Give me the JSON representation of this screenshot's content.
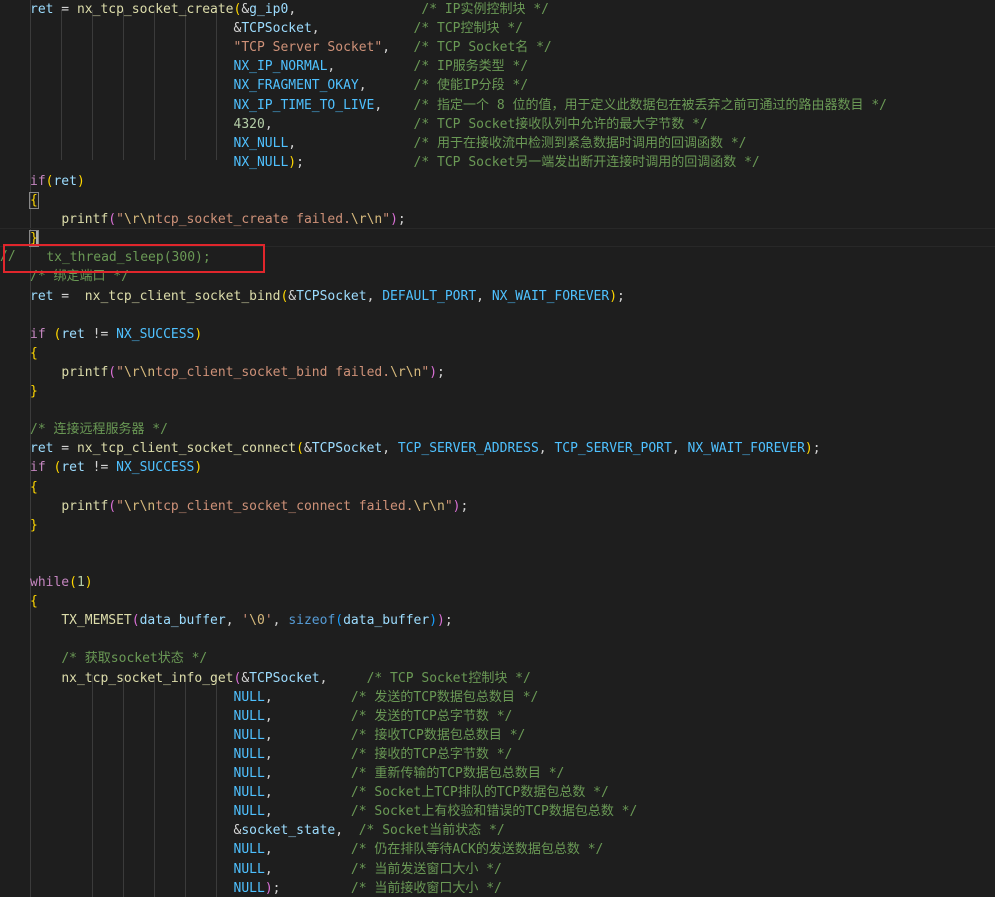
{
  "editor": {
    "colors": {
      "background": "#1e1e1e",
      "keyword": "#c586c0",
      "type": "#569cd6",
      "function": "#dcdcaa",
      "variable": "#9cdcfe",
      "macro": "#4fc1ff",
      "number": "#b5cea8",
      "string": "#ce9178",
      "comment": "#6a9955",
      "highlight_box": "#e0262c"
    },
    "lines": [
      [
        [
          "var",
          "ret"
        ],
        [
          "txt",
          " = "
        ],
        [
          "fn",
          "nx_tcp_socket_create"
        ],
        [
          "br1",
          "("
        ],
        [
          "txt",
          "&"
        ],
        [
          "var",
          "g_ip0"
        ],
        [
          "txt",
          ","
        ],
        [
          "txt",
          "                "
        ],
        [
          "cmt",
          "/* IP实例控制块 */"
        ]
      ],
      [
        [
          "txt",
          "                          &"
        ],
        [
          "var",
          "TCPSocket"
        ],
        [
          "txt",
          ","
        ],
        [
          "txt",
          "            "
        ],
        [
          "cmt",
          "/* TCP控制块 */"
        ]
      ],
      [
        [
          "txt",
          "                          "
        ],
        [
          "str",
          "\"TCP Server Socket\""
        ],
        [
          "txt",
          ",   "
        ],
        [
          "cmt",
          "/* TCP Socket名 */"
        ]
      ],
      [
        [
          "txt",
          "                          "
        ],
        [
          "mac",
          "NX_IP_NORMAL"
        ],
        [
          "txt",
          ","
        ],
        [
          "txt",
          "          "
        ],
        [
          "cmt",
          "/* IP服务类型 */"
        ]
      ],
      [
        [
          "txt",
          "                          "
        ],
        [
          "mac",
          "NX_FRAGMENT_OKAY"
        ],
        [
          "txt",
          ","
        ],
        [
          "txt",
          "      "
        ],
        [
          "cmt",
          "/* 使能IP分段 */"
        ]
      ],
      [
        [
          "txt",
          "                          "
        ],
        [
          "mac",
          "NX_IP_TIME_TO_LIVE"
        ],
        [
          "txt",
          ","
        ],
        [
          "txt",
          "    "
        ],
        [
          "cmt",
          "/* 指定一个 8 位的值，用于定义此数据包在被丢弃之前可通过的路由器数目 */"
        ]
      ],
      [
        [
          "txt",
          "                          "
        ],
        [
          "num",
          "4320"
        ],
        [
          "txt",
          ","
        ],
        [
          "txt",
          "                  "
        ],
        [
          "cmt",
          "/* TCP Socket接收队列中允许的最大字节数 */"
        ]
      ],
      [
        [
          "txt",
          "                          "
        ],
        [
          "mac",
          "NX_NULL"
        ],
        [
          "txt",
          ","
        ],
        [
          "txt",
          "               "
        ],
        [
          "cmt",
          "/* 用于在接收流中检测到紧急数据时调用的回调函数 */"
        ]
      ],
      [
        [
          "txt",
          "                          "
        ],
        [
          "mac",
          "NX_NULL"
        ],
        [
          "br1",
          ")"
        ],
        [
          "txt",
          ";"
        ],
        [
          "txt",
          "              "
        ],
        [
          "cmt",
          "/* TCP Socket另一端发出断开连接时调用的回调函数 */"
        ]
      ],
      [
        [
          "kw",
          "if"
        ],
        [
          "br1",
          "("
        ],
        [
          "var",
          "ret"
        ],
        [
          "br1",
          ")"
        ]
      ],
      [
        [
          "br1bm",
          "{"
        ]
      ],
      [
        [
          "txt",
          "    "
        ],
        [
          "fn",
          "printf"
        ],
        [
          "br2",
          "("
        ],
        [
          "str",
          "\""
        ],
        [
          "esc",
          "\\r\\n"
        ],
        [
          "str",
          "tcp_socket_create failed."
        ],
        [
          "esc",
          "\\r\\n"
        ],
        [
          "str",
          "\""
        ],
        [
          "br2",
          ")"
        ],
        [
          "txt",
          ";"
        ]
      ],
      [
        [
          "br1bm",
          "}"
        ]
      ],
      [
        [
          "txt",
          "    "
        ],
        [
          "cmt",
          "tx_thread_sleep(300);"
        ]
      ],
      [
        [
          "cmt",
          "/* 绑定端口 */"
        ]
      ],
      [
        [
          "var",
          "ret"
        ],
        [
          "txt",
          " =  "
        ],
        [
          "fn",
          "nx_tcp_client_socket_bind"
        ],
        [
          "br1",
          "("
        ],
        [
          "txt",
          "&"
        ],
        [
          "var",
          "TCPSocket"
        ],
        [
          "txt",
          ", "
        ],
        [
          "mac",
          "DEFAULT_PORT"
        ],
        [
          "txt",
          ", "
        ],
        [
          "mac",
          "NX_WAIT_FOREVER"
        ],
        [
          "br1",
          ")"
        ],
        [
          "txt",
          ";"
        ]
      ],
      [],
      [
        [
          "kw",
          "if"
        ],
        [
          "txt",
          " "
        ],
        [
          "br1",
          "("
        ],
        [
          "var",
          "ret"
        ],
        [
          "txt",
          " != "
        ],
        [
          "mac",
          "NX_SUCCESS"
        ],
        [
          "br1",
          ")"
        ]
      ],
      [
        [
          "br1",
          "{"
        ]
      ],
      [
        [
          "txt",
          "    "
        ],
        [
          "fn",
          "printf"
        ],
        [
          "br2",
          "("
        ],
        [
          "str",
          "\""
        ],
        [
          "esc",
          "\\r\\n"
        ],
        [
          "str",
          "tcp_client_socket_bind failed."
        ],
        [
          "esc",
          "\\r\\n"
        ],
        [
          "str",
          "\""
        ],
        [
          "br2",
          ")"
        ],
        [
          "txt",
          ";"
        ]
      ],
      [
        [
          "br1",
          "}"
        ]
      ],
      [],
      [
        [
          "cmt",
          "/* 连接远程服务器 */"
        ]
      ],
      [
        [
          "var",
          "ret"
        ],
        [
          "txt",
          " = "
        ],
        [
          "fn",
          "nx_tcp_client_socket_connect"
        ],
        [
          "br1",
          "("
        ],
        [
          "txt",
          "&"
        ],
        [
          "var",
          "TCPSocket"
        ],
        [
          "txt",
          ", "
        ],
        [
          "mac",
          "TCP_SERVER_ADDRESS"
        ],
        [
          "txt",
          ", "
        ],
        [
          "mac",
          "TCP_SERVER_PORT"
        ],
        [
          "txt",
          ", "
        ],
        [
          "mac",
          "NX_WAIT_FOREVER"
        ],
        [
          "br1",
          ")"
        ],
        [
          "txt",
          ";"
        ]
      ],
      [
        [
          "kw",
          "if"
        ],
        [
          "txt",
          " "
        ],
        [
          "br1",
          "("
        ],
        [
          "var",
          "ret"
        ],
        [
          "txt",
          " != "
        ],
        [
          "mac",
          "NX_SUCCESS"
        ],
        [
          "br1",
          ")"
        ]
      ],
      [
        [
          "br1",
          "{"
        ]
      ],
      [
        [
          "txt",
          "    "
        ],
        [
          "fn",
          "printf"
        ],
        [
          "br2",
          "("
        ],
        [
          "str",
          "\""
        ],
        [
          "esc",
          "\\r\\n"
        ],
        [
          "str",
          "tcp_client_socket_connect failed."
        ],
        [
          "esc",
          "\\r\\n"
        ],
        [
          "str",
          "\""
        ],
        [
          "br2",
          ")"
        ],
        [
          "txt",
          ";"
        ]
      ],
      [
        [
          "br1",
          "}"
        ]
      ],
      [],
      [],
      [
        [
          "kw",
          "while"
        ],
        [
          "br1",
          "("
        ],
        [
          "num",
          "1"
        ],
        [
          "br1",
          ")"
        ]
      ],
      [
        [
          "br1",
          "{"
        ]
      ],
      [
        [
          "txt",
          "    "
        ],
        [
          "fn",
          "TX_MEMSET"
        ],
        [
          "br2",
          "("
        ],
        [
          "var",
          "data_buffer"
        ],
        [
          "txt",
          ", "
        ],
        [
          "str",
          "'"
        ],
        [
          "esc",
          "\\0"
        ],
        [
          "str",
          "'"
        ],
        [
          "txt",
          ", "
        ],
        [
          "ty",
          "sizeof"
        ],
        [
          "br3",
          "("
        ],
        [
          "var",
          "data_buffer"
        ],
        [
          "br3",
          ")"
        ],
        [
          "br2",
          ")"
        ],
        [
          "txt",
          ";"
        ]
      ],
      [],
      [
        [
          "txt",
          "    "
        ],
        [
          "cmt",
          "/* 获取socket状态 */"
        ]
      ],
      [
        [
          "txt",
          "    "
        ],
        [
          "fn",
          "nx_tcp_socket_info_get"
        ],
        [
          "br2",
          "("
        ],
        [
          "txt",
          "&"
        ],
        [
          "var",
          "TCPSocket"
        ],
        [
          "txt",
          ","
        ],
        [
          "txt",
          "     "
        ],
        [
          "cmt",
          "/* TCP Socket控制块 */"
        ]
      ],
      [
        [
          "txt",
          "                          "
        ],
        [
          "mac",
          "NULL"
        ],
        [
          "txt",
          ","
        ],
        [
          "txt",
          "          "
        ],
        [
          "cmt",
          "/* 发送的TCP数据包总数目 */"
        ]
      ],
      [
        [
          "txt",
          "                          "
        ],
        [
          "mac",
          "NULL"
        ],
        [
          "txt",
          ","
        ],
        [
          "txt",
          "          "
        ],
        [
          "cmt",
          "/* 发送的TCP总字节数 */"
        ]
      ],
      [
        [
          "txt",
          "                          "
        ],
        [
          "mac",
          "NULL"
        ],
        [
          "txt",
          ","
        ],
        [
          "txt",
          "          "
        ],
        [
          "cmt",
          "/* 接收TCP数据包总数目 */"
        ]
      ],
      [
        [
          "txt",
          "                          "
        ],
        [
          "mac",
          "NULL"
        ],
        [
          "txt",
          ","
        ],
        [
          "txt",
          "          "
        ],
        [
          "cmt",
          "/* 接收的TCP总字节数 */"
        ]
      ],
      [
        [
          "txt",
          "                          "
        ],
        [
          "mac",
          "NULL"
        ],
        [
          "txt",
          ","
        ],
        [
          "txt",
          "          "
        ],
        [
          "cmt",
          "/* 重新传输的TCP数据包总数目 */"
        ]
      ],
      [
        [
          "txt",
          "                          "
        ],
        [
          "mac",
          "NULL"
        ],
        [
          "txt",
          ","
        ],
        [
          "txt",
          "          "
        ],
        [
          "cmt",
          "/* Socket上TCP排队的TCP数据包总数 */"
        ]
      ],
      [
        [
          "txt",
          "                          "
        ],
        [
          "mac",
          "NULL"
        ],
        [
          "txt",
          ","
        ],
        [
          "txt",
          "          "
        ],
        [
          "cmt",
          "/* Socket上有校验和错误的TCP数据包总数 */"
        ]
      ],
      [
        [
          "txt",
          "                          &"
        ],
        [
          "var",
          "socket_state"
        ],
        [
          "txt",
          ","
        ],
        [
          "txt",
          "  "
        ],
        [
          "cmt",
          "/* Socket当前状态 */"
        ]
      ],
      [
        [
          "txt",
          "                          "
        ],
        [
          "mac",
          "NULL"
        ],
        [
          "txt",
          ","
        ],
        [
          "txt",
          "          "
        ],
        [
          "cmt",
          "/* 仍在排队等待ACK的发送数据包总数 */"
        ]
      ],
      [
        [
          "txt",
          "                          "
        ],
        [
          "mac",
          "NULL"
        ],
        [
          "txt",
          ","
        ],
        [
          "txt",
          "          "
        ],
        [
          "cmt",
          "/* 当前发送窗口大小 */"
        ]
      ],
      [
        [
          "txt",
          "                          "
        ],
        [
          "mac",
          "NULL"
        ],
        [
          "br2",
          ")"
        ],
        [
          "txt",
          ";"
        ],
        [
          "txt",
          "         "
        ],
        [
          "cmt",
          "/* 当前接收窗口大小 */"
        ]
      ]
    ],
    "margin_comment": "//"
  }
}
